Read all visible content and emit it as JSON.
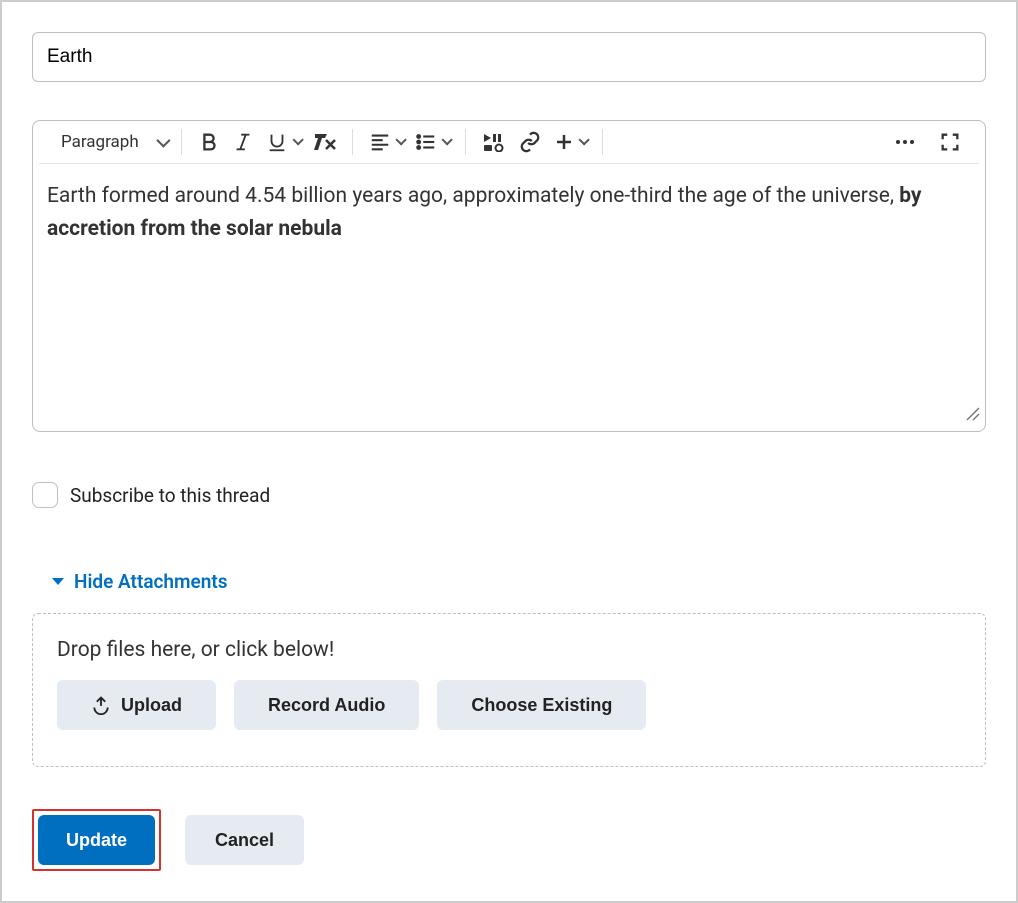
{
  "title_value": "Earth",
  "toolbar": {
    "paragraph_label": "Paragraph"
  },
  "body_text": "Earth formed around 4.54 billion years ago, approximately one-third the age of the universe, ",
  "body_bold": "by accretion from the solar nebula",
  "subscribe_label": "Subscribe to this thread",
  "attachments": {
    "toggle_label": "Hide Attachments",
    "drop_prompt": "Drop files here, or click below!",
    "upload_label": "Upload",
    "record_label": "Record Audio",
    "choose_label": "Choose Existing"
  },
  "actions": {
    "update": "Update",
    "cancel": "Cancel"
  }
}
